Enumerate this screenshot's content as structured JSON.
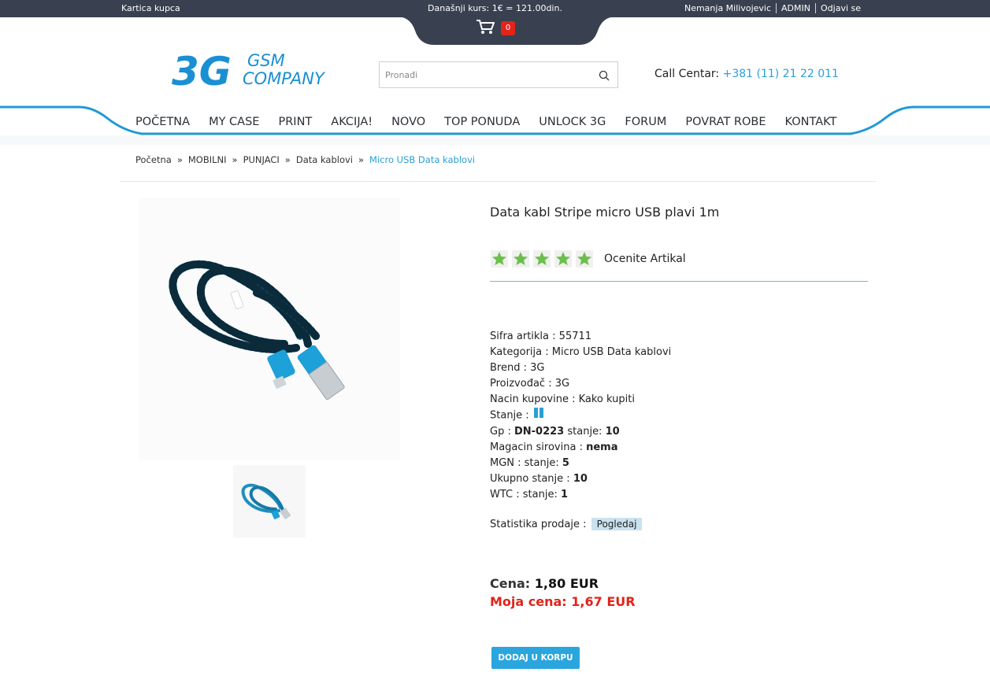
{
  "topbar": {
    "left_link": "Kartica kupca",
    "exchange_rate": "Današnji kurs: 1€ = 121.00din.",
    "user_name": "Nemanja Milivojevic",
    "admin_link": "ADMIN",
    "logout_link": "Odjavi se"
  },
  "cart": {
    "count": "0",
    "icon": "cart-icon"
  },
  "logo": {
    "mark": "3G",
    "line1": "GSM",
    "line2": "COMPANY"
  },
  "search": {
    "placeholder": "Pronađi",
    "value": ""
  },
  "call_center": {
    "label": "Call Centar:",
    "phone": "+381 (11) 21 22 011"
  },
  "nav": [
    {
      "label": "POČETNA"
    },
    {
      "label": "MY CASE"
    },
    {
      "label": "PRINT"
    },
    {
      "label": "AKCIJA!"
    },
    {
      "label": "NOVO"
    },
    {
      "label": "TOP PONUDA"
    },
    {
      "label": "UNLOCK 3G"
    },
    {
      "label": "FORUM"
    },
    {
      "label": "POVRAT ROBE"
    },
    {
      "label": "KONTAKT"
    }
  ],
  "breadcrumb": {
    "items": [
      "Početna",
      "MOBILNI",
      "PUNJACI",
      "Data kablovi"
    ],
    "current": "Micro USB Data kablovi",
    "separator": "»"
  },
  "product": {
    "title": "Data kabl Stripe micro USB plavi 1m",
    "rating_stars": 5,
    "rate_label": "Ocenite Artikal",
    "details": {
      "sifra_label": "Sifra artikla :",
      "sifra_value": "55711",
      "kategorija_label": "Kategorija :",
      "kategorija_value": "Micro USB Data kablovi",
      "brend_label": "Brend :",
      "brend_value": "3G",
      "proizvodjac_label": "Proizvođač :",
      "proizvodjac_value": "3G",
      "nacin_label": "Nacin kupovine :",
      "nacin_value": "Kako kupiti",
      "stanje_label": "Stanje :",
      "gp_label": "Gp :",
      "gp_code": "DN-0223",
      "gp_stanje_label": "stanje:",
      "gp_stanje_value": "10",
      "magacin_label": "Magacin sirovina :",
      "magacin_value": "nema",
      "mgn_label": "MGN : stanje:",
      "mgn_value": "5",
      "ukupno_label": "Ukupno stanje :",
      "ukupno_value": "10",
      "wtc_label": "WTC : stanje:",
      "wtc_value": "1"
    },
    "stats_label": "Statistika prodaje :",
    "stats_button": "Pogledaj",
    "price_label": "Cena:",
    "price_value": "1,80 EUR",
    "my_price_label": "Moja cena:",
    "my_price_value": "1,67 EUR",
    "add_to_cart": "DODAJ U KORPU"
  },
  "colors": {
    "topbar": "#394150",
    "accent": "#2a9fd8",
    "my_price": "#e2231a",
    "star_green": "#6cc04a"
  }
}
